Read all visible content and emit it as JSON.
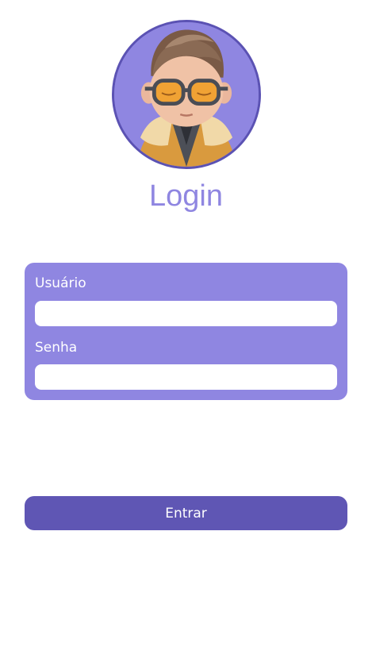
{
  "header": {
    "avatar_icon": "avatar-3d-character",
    "title": "Login"
  },
  "form": {
    "username_label": "Usuário",
    "username_value": "",
    "password_label": "Senha",
    "password_value": ""
  },
  "actions": {
    "submit_label": "Entrar"
  },
  "colors": {
    "accent": "#8f86e1",
    "accent_dark": "#5f56b4",
    "avatar_border": "#5b52b3",
    "background": "#ffffff"
  }
}
